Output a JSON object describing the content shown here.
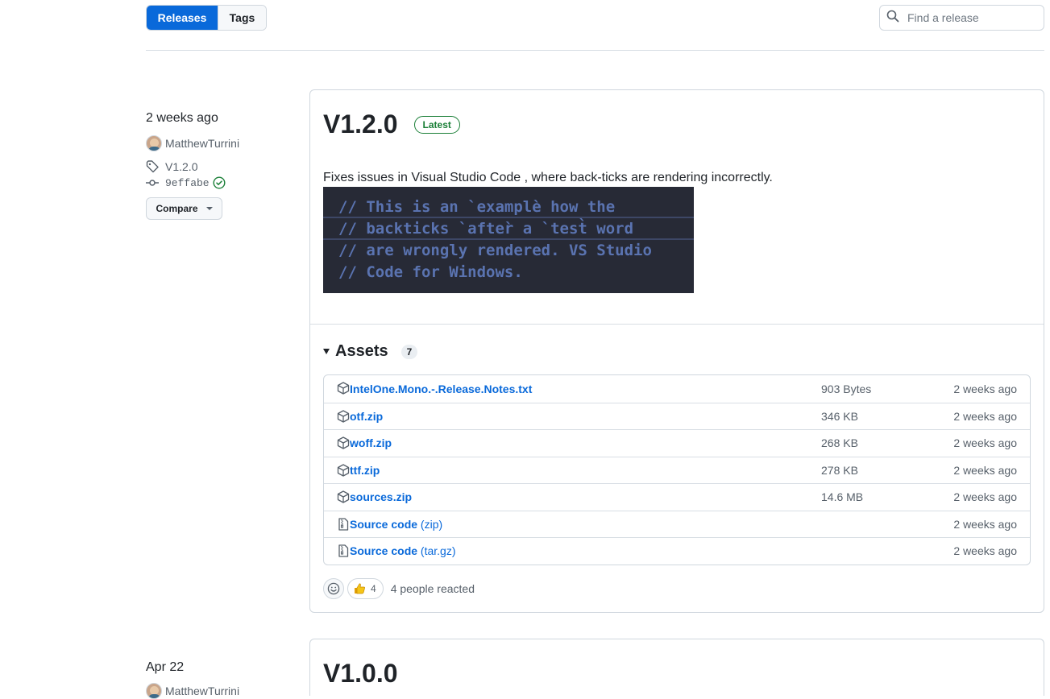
{
  "tabs": {
    "releases": "Releases",
    "tags": "Tags"
  },
  "search": {
    "placeholder": "Find a release"
  },
  "release1": {
    "date": "2 weeks ago",
    "author": "MatthewTurrini",
    "tag": "V1.2.0",
    "commit": "9effabe",
    "compare_label": "Compare",
    "title": "V1.2.0",
    "badge": "Latest",
    "description": "Fixes issues in Visual Studio Code , where back-ticks are rendering incorrectly.",
    "code_lines": [
      "// This is an `examplè how the",
      "// backticks `after̀ a `test̀ word",
      "// are wrongly rendered. VS Studio",
      "// Code for Windows."
    ],
    "assets_title": "Assets",
    "assets_count": "7",
    "assets": [
      {
        "name": "IntelOne.Mono.-.Release.Notes.txt",
        "sub": "",
        "size": "903 Bytes",
        "time": "2 weeks ago",
        "icon": "package-icon"
      },
      {
        "name": "otf.zip",
        "sub": "",
        "size": "346 KB",
        "time": "2 weeks ago",
        "icon": "package-icon"
      },
      {
        "name": "woff.zip",
        "sub": "",
        "size": "268 KB",
        "time": "2 weeks ago",
        "icon": "package-icon"
      },
      {
        "name": "ttf.zip",
        "sub": "",
        "size": "278 KB",
        "time": "2 weeks ago",
        "icon": "package-icon"
      },
      {
        "name": "sources.zip",
        "sub": "",
        "size": "14.6 MB",
        "time": "2 weeks ago",
        "icon": "package-icon"
      },
      {
        "name": "Source code",
        "sub": "(zip)",
        "size": "",
        "time": "2 weeks ago",
        "icon": "file-zip-icon"
      },
      {
        "name": "Source code",
        "sub": "(tar.gz)",
        "size": "",
        "time": "2 weeks ago",
        "icon": "file-zip-icon"
      }
    ],
    "thumbs_count": "4",
    "reacted_text": "4 people reacted"
  },
  "release2": {
    "date": "Apr 22",
    "author": "MatthewTurrini",
    "title": "V1.0.0"
  },
  "colors": {
    "accent": "#0969da",
    "latest": "#1a7f37",
    "code_bg": "#272a36"
  }
}
